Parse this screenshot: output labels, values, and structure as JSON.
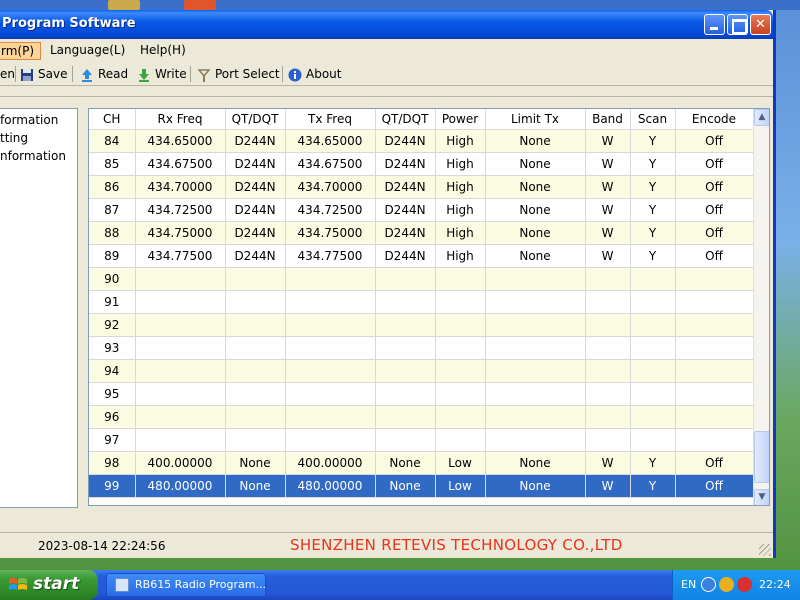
{
  "window": {
    "title": "Program Software"
  },
  "menu": {
    "items": [
      "rm(P)",
      "Language(L)",
      "Help(H)"
    ]
  },
  "toolbar": {
    "open_label": "en",
    "save_label": "Save",
    "read_label": "Read",
    "write_label": "Write",
    "port_label": "Port Select",
    "about_label": "About"
  },
  "tree": {
    "items": [
      "formation",
      "tting",
      "nformation"
    ]
  },
  "grid": {
    "columns": [
      "CH",
      "Rx Freq",
      "QT/DQT",
      "Tx Freq",
      "QT/DQT",
      "Power",
      "Limit Tx",
      "Band",
      "Scan",
      "Encode"
    ],
    "rows": [
      [
        "84",
        "434.65000",
        "D244N",
        "434.65000",
        "D244N",
        "High",
        "None",
        "W",
        "Y",
        "Off"
      ],
      [
        "85",
        "434.67500",
        "D244N",
        "434.67500",
        "D244N",
        "High",
        "None",
        "W",
        "Y",
        "Off"
      ],
      [
        "86",
        "434.70000",
        "D244N",
        "434.70000",
        "D244N",
        "High",
        "None",
        "W",
        "Y",
        "Off"
      ],
      [
        "87",
        "434.72500",
        "D244N",
        "434.72500",
        "D244N",
        "High",
        "None",
        "W",
        "Y",
        "Off"
      ],
      [
        "88",
        "434.75000",
        "D244N",
        "434.75000",
        "D244N",
        "High",
        "None",
        "W",
        "Y",
        "Off"
      ],
      [
        "89",
        "434.77500",
        "D244N",
        "434.77500",
        "D244N",
        "High",
        "None",
        "W",
        "Y",
        "Off"
      ],
      [
        "90",
        "",
        "",
        "",
        "",
        "",
        "",
        "",
        "",
        ""
      ],
      [
        "91",
        "",
        "",
        "",
        "",
        "",
        "",
        "",
        "",
        ""
      ],
      [
        "92",
        "",
        "",
        "",
        "",
        "",
        "",
        "",
        "",
        ""
      ],
      [
        "93",
        "",
        "",
        "",
        "",
        "",
        "",
        "",
        "",
        ""
      ],
      [
        "94",
        "",
        "",
        "",
        "",
        "",
        "",
        "",
        "",
        ""
      ],
      [
        "95",
        "",
        "",
        "",
        "",
        "",
        "",
        "",
        "",
        ""
      ],
      [
        "96",
        "",
        "",
        "",
        "",
        "",
        "",
        "",
        "",
        ""
      ],
      [
        "97",
        "",
        "",
        "",
        "",
        "",
        "",
        "",
        "",
        ""
      ],
      [
        "98",
        "400.00000",
        "None",
        "400.00000",
        "None",
        "Low",
        "None",
        "W",
        "Y",
        "Off"
      ],
      [
        "99",
        "480.00000",
        "None",
        "480.00000",
        "None",
        "Low",
        "None",
        "W",
        "Y",
        "Off"
      ]
    ],
    "selected_channel": "99"
  },
  "status": {
    "datetime": "2023-08-14  22:24:56",
    "company": "SHENZHEN RETEVIS TECHNOLOGY CO.,LTD"
  },
  "taskbar": {
    "start_label": "start",
    "task_label": "RB615 Radio Program...",
    "lang": "EN",
    "clock": "22:24"
  },
  "colors": {
    "selected_row": "#316ac5",
    "alt_row": "#fbfbe2",
    "company_text": "#e8321e",
    "title_bar": "#0a59e6"
  }
}
